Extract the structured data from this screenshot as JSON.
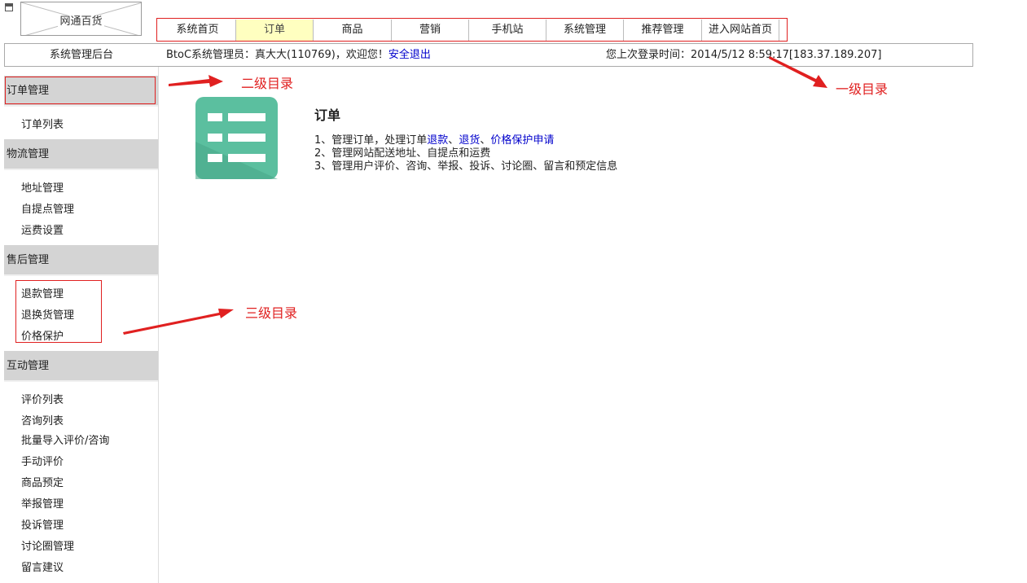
{
  "logo": {
    "text": "网通百货"
  },
  "nav": {
    "items": [
      {
        "label": "系统首页",
        "active": false
      },
      {
        "label": "订单",
        "active": true
      },
      {
        "label": "商品",
        "active": false
      },
      {
        "label": "营销",
        "active": false
      },
      {
        "label": "手机站",
        "active": false
      },
      {
        "label": "系统管理",
        "active": false
      },
      {
        "label": "推荐管理",
        "active": false
      },
      {
        "label": "进入网站首页",
        "active": false
      }
    ]
  },
  "info": {
    "title": "系统管理后台",
    "admin_text": "BtoC系统管理员：真大大(110769)，欢迎您！",
    "logout": "安全退出",
    "last_login_label": "您上次登录时间：",
    "last_login_value": "2014/5/12 8:59:17[183.37.189.207]"
  },
  "sidebar": {
    "sections": [
      {
        "title": "订单管理",
        "items": [
          "订单列表"
        ]
      },
      {
        "title": "物流管理",
        "items": [
          "地址管理",
          "自提点管理",
          "运费设置"
        ]
      },
      {
        "title": "售后管理",
        "items": [
          "退款管理",
          "退换货管理",
          "价格保护"
        ]
      },
      {
        "title": "互动管理",
        "items": [
          "评价列表",
          "咨询列表",
          "批量导入评价/咨询",
          "手动评价",
          "商品预定",
          "举报管理",
          "投诉管理",
          "讨论圈管理",
          "留言建议"
        ]
      }
    ]
  },
  "annotations": {
    "level1": "一级目录",
    "level2": "二级目录",
    "level3": "三级目录"
  },
  "content": {
    "icon": "list-document-icon",
    "title": "订单",
    "line1": {
      "prefix": "1、管理订单，处理订单",
      "link1": "退款",
      "sep1": "、",
      "link2": "退货",
      "sep2": "、",
      "link3": "价格保护申请"
    },
    "line2": "2、管理网站配送地址、自提点和运费",
    "line3": "3、管理用户评价、咨询、举报、投诉、讨论圈、留言和预定信息"
  },
  "colors": {
    "annotation_red": "#e02020",
    "active_tab": "#ffffc0",
    "section_bg": "#d4d4d4",
    "link_blue": "#0000cc",
    "icon_green": "#5bbf9f"
  }
}
